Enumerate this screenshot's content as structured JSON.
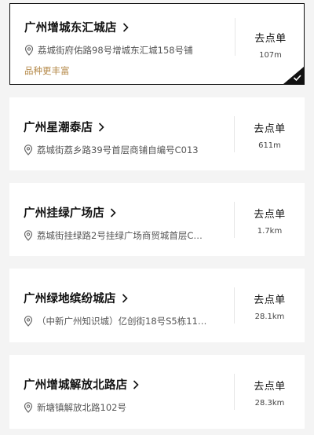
{
  "stores": [
    {
      "name": "广州增城东汇城店",
      "address": "荔城街府佑路98号增城东汇城158号铺",
      "tag": "品种更丰富",
      "order_label": "去点单",
      "distance": "107m",
      "selected": true
    },
    {
      "name": "广州星潮泰店",
      "address": "荔城街荔乡路39号首层商铺自编号C013",
      "order_label": "去点单",
      "distance": "611m",
      "selected": false
    },
    {
      "name": "广州挂绿广场店",
      "address": "荔城街挂绿路2号挂绿广场商贸城首层C…",
      "order_label": "去点单",
      "distance": "1.7km",
      "selected": false
    },
    {
      "name": "广州绿地缤纷城店",
      "address": "（中新广州知识城）亿创街18号S5栋11…",
      "order_label": "去点单",
      "distance": "28.1km",
      "selected": false
    },
    {
      "name": "广州增城解放北路店",
      "address": "新塘镇解放北路102号",
      "order_label": "去点单",
      "distance": "28.3km",
      "selected": false
    }
  ]
}
